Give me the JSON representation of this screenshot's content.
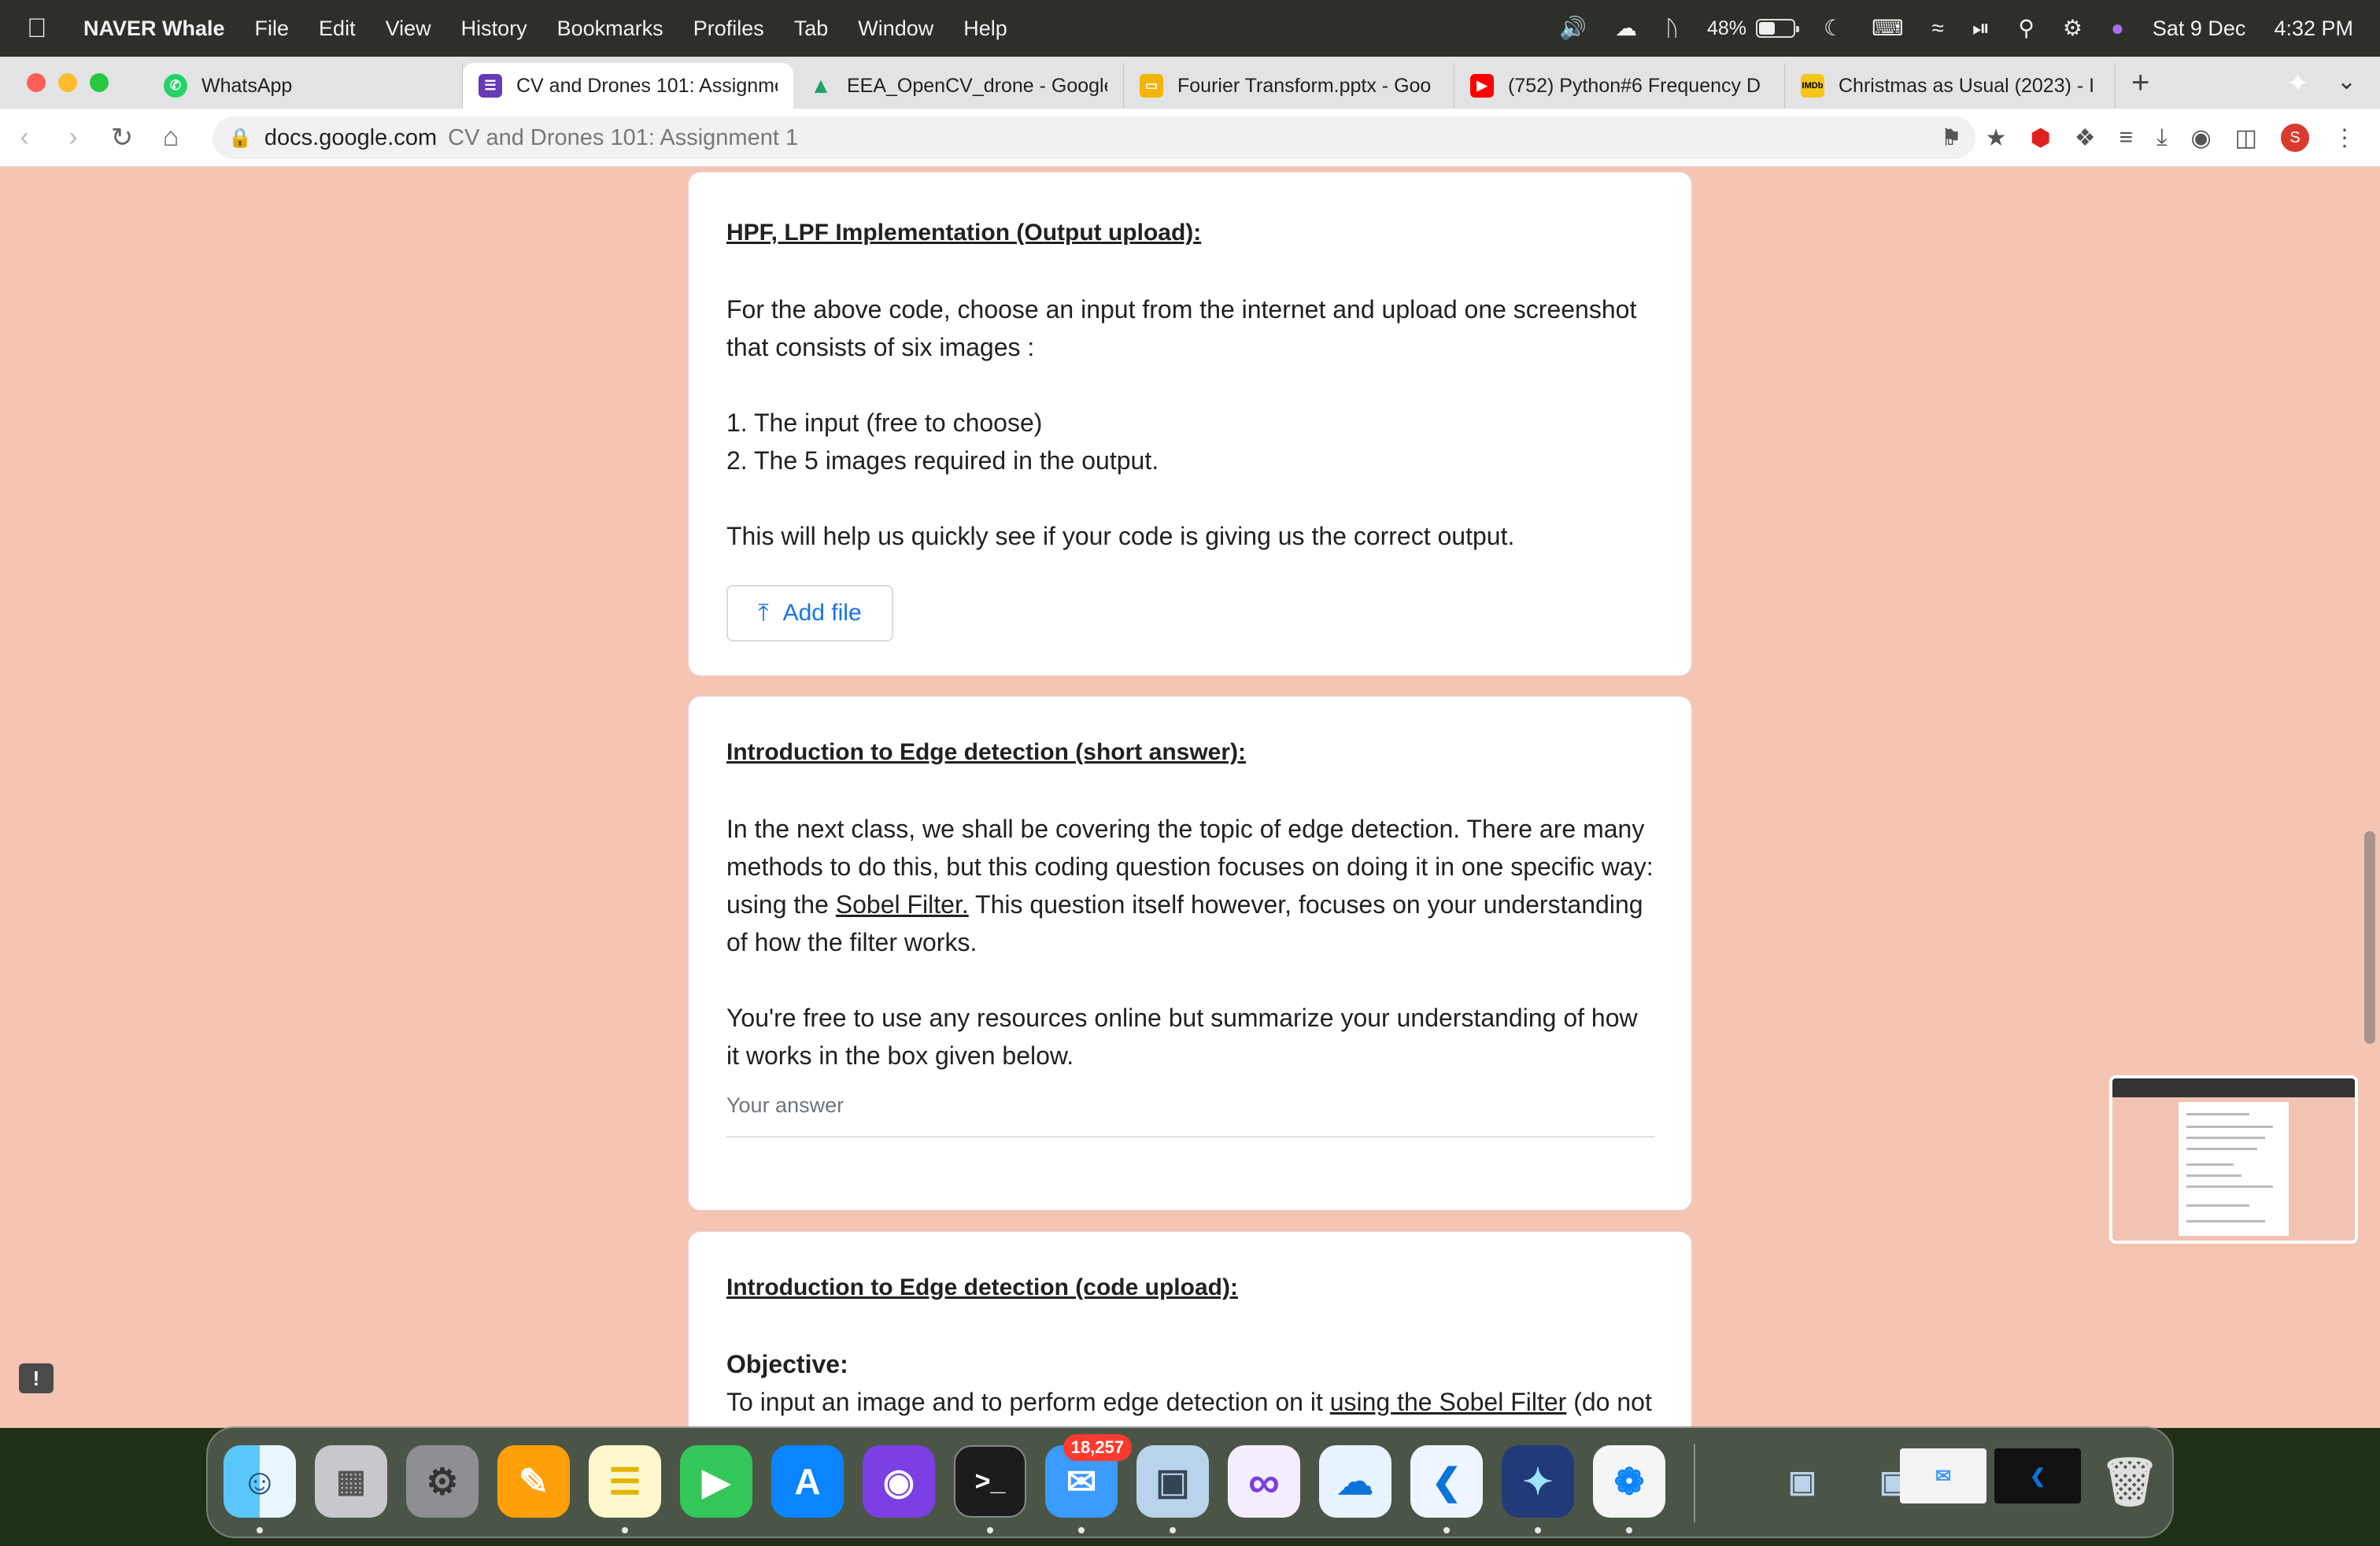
{
  "menubar": {
    "app_name": "NAVER Whale",
    "items": [
      "File",
      "Edit",
      "View",
      "History",
      "Bookmarks",
      "Profiles",
      "Tab",
      "Window",
      "Help"
    ],
    "battery_percent": "48%",
    "battery_level": 0.48,
    "date": "Sat 9 Dec",
    "time": "4:32 PM"
  },
  "tabs": [
    {
      "title": "WhatsApp",
      "icon": "whatsapp-icon",
      "color": "#25d366"
    },
    {
      "title": "CV and Drones 101: Assignme",
      "icon": "google-forms-icon",
      "color": "#673ab7",
      "active": true
    },
    {
      "title": "EEA_OpenCV_drone - Google",
      "icon": "google-drive-icon",
      "color": "#1fa463"
    },
    {
      "title": "Fourier Transform.pptx - Goo",
      "icon": "google-slides-icon",
      "color": "#f4b400"
    },
    {
      "title": "(752) Python#6 Frequency D",
      "icon": "youtube-icon",
      "color": "#ff0000"
    },
    {
      "title": "Christmas as Usual (2023) - I",
      "icon": "imdb-icon",
      "color": "#f5c518"
    }
  ],
  "address": {
    "domain": "docs.google.com",
    "path": "CV and Drones 101: Assignment 1"
  },
  "profile_initial": "S",
  "card1": {
    "heading": "HPF, LPF Implementation (Output upload):",
    "para1": "For the above code, choose an input from the internet and upload one screenshot that consists of six images :",
    "item1": "1. The input (free to choose)",
    "item2": "2. The 5 images required in the output.",
    "para2": "This will help us quickly see if your code is giving us the correct output.",
    "button": "Add file"
  },
  "card2": {
    "heading": "Introduction to Edge detection (short answer):",
    "para1_a": "In the next class, we shall be covering the topic of edge detection. There are many methods to do this, but this coding question focuses on doing it in one specific way: using the ",
    "para1_link": "Sobel Filter.",
    "para1_b": " This question itself however, focuses on your understanding of how the filter works.",
    "para2": "You're free to use any resources online but summarize your understanding of how it works in the box given below.",
    "answer_placeholder": "Your answer"
  },
  "card3": {
    "heading": "Introduction to Edge detection (code upload):",
    "objective_label": "Objective:",
    "objective_a": "To input an image and to perform edge detection on it ",
    "objective_link": "using the Sobel Filter",
    "objective_b": " (do not"
  },
  "dock": {
    "mail_badge": "18,257",
    "apps": [
      "Finder",
      "Launchpad",
      "System Settings",
      "Pages",
      "Notes",
      "FaceTime",
      "App Store",
      "GitHub Desktop",
      "Terminal",
      "Mail",
      "Preview",
      "Visual Studio",
      "OneDrive",
      "Visual Studio Code",
      "NAVER Whale",
      "Safari"
    ]
  }
}
